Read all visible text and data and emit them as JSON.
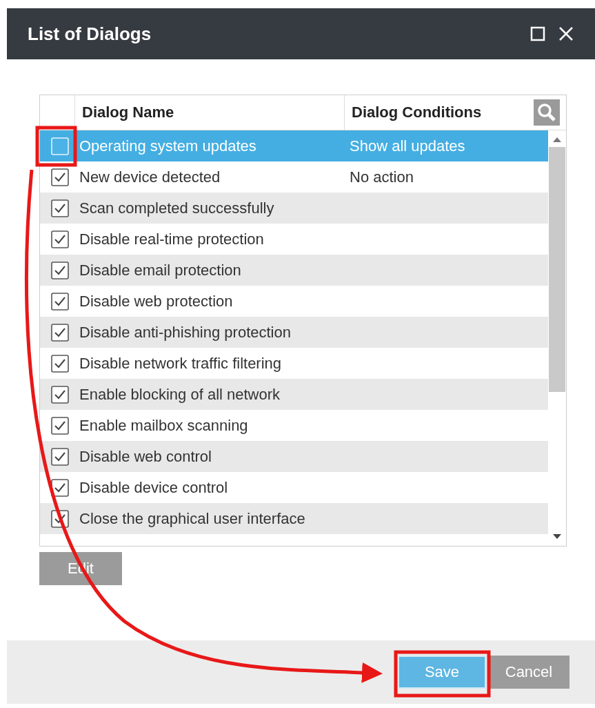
{
  "window": {
    "title": "List of Dialogs"
  },
  "table": {
    "columns": [
      "Dialog Name",
      "Dialog Conditions"
    ],
    "rows": [
      {
        "name": "Operating system updates",
        "condition": "Show all updates",
        "checked": false,
        "selected": true
      },
      {
        "name": "New device detected",
        "condition": "No action",
        "checked": true,
        "selected": false
      },
      {
        "name": "Scan completed successfully",
        "checked": true,
        "selected": false
      },
      {
        "name": "Disable real-time protection",
        "checked": true,
        "selected": false
      },
      {
        "name": "Disable email protection",
        "checked": true,
        "selected": false
      },
      {
        "name": "Disable web protection",
        "checked": true,
        "selected": false
      },
      {
        "name": "Disable anti-phishing protection",
        "checked": true,
        "selected": false
      },
      {
        "name": "Disable network traffic filtering",
        "checked": true,
        "selected": false
      },
      {
        "name": "Enable blocking of all network",
        "checked": true,
        "selected": false
      },
      {
        "name": "Enable mailbox scanning",
        "checked": true,
        "selected": false
      },
      {
        "name": "Disable web control",
        "checked": true,
        "selected": false
      },
      {
        "name": "Disable device control",
        "checked": true,
        "selected": false
      },
      {
        "name": "Close the graphical user interface",
        "checked": true,
        "selected": false
      }
    ]
  },
  "edit_button": "Edit",
  "footer": {
    "buttons": [
      "Save",
      "Cancel"
    ]
  }
}
